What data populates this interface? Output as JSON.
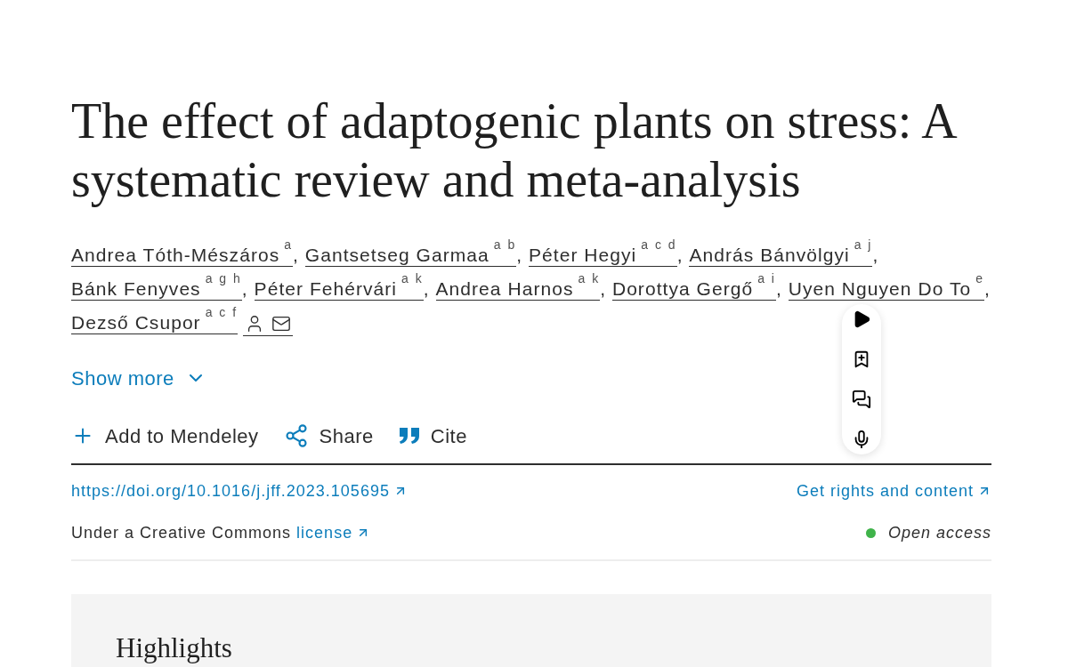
{
  "article": {
    "title": "The effect of adaptogenic plants on stress: A systematic review and meta-analysis",
    "authors": [
      {
        "name": "Andrea Tóth-Mészáros",
        "affiliations": "a",
        "separator": ",",
        "corresponding": false
      },
      {
        "name": "Gantsetseg Garmaa",
        "affiliations": "a b",
        "separator": ",",
        "corresponding": false
      },
      {
        "name": "Péter Hegyi",
        "affiliations": "a c d",
        "separator": ",",
        "corresponding": false
      },
      {
        "name": "András Bánvölgyi",
        "affiliations": "a j",
        "separator": ",",
        "corresponding": false
      },
      {
        "name": "Bánk Fenyves",
        "affiliations": "a g h",
        "separator": ",",
        "corresponding": false
      },
      {
        "name": "Péter Fehérvári",
        "affiliations": "a k",
        "separator": ",",
        "corresponding": false
      },
      {
        "name": "Andrea Harnos",
        "affiliations": "a k",
        "separator": ",",
        "corresponding": false
      },
      {
        "name": "Dorottya Gergő",
        "affiliations": "a i",
        "separator": ",",
        "corresponding": false
      },
      {
        "name": "Uyen Nguyen Do To",
        "affiliations": "e",
        "separator": ",",
        "corresponding": false
      },
      {
        "name": "Dezső Csupor",
        "affiliations": "a c f",
        "corresponding": true
      }
    ],
    "show_more": "Show more",
    "actions": [
      {
        "kind": "add",
        "label": "Add to Mendeley"
      },
      {
        "kind": "share",
        "label": "Share"
      },
      {
        "kind": "cite",
        "label": "Cite"
      }
    ],
    "doi_link": "https://doi.org/10.1016/j.jff.2023.105695",
    "rights_link": "Get rights and content",
    "license": {
      "text": "Under a Creative Commons",
      "link": "license"
    },
    "access": "Open access",
    "highlights": {
      "heading": "Highlights"
    }
  },
  "floating_toolbar": {
    "tools": [
      {
        "kind": "play"
      },
      {
        "kind": "bookmark"
      },
      {
        "kind": "comments"
      },
      {
        "kind": "voice"
      }
    ]
  }
}
